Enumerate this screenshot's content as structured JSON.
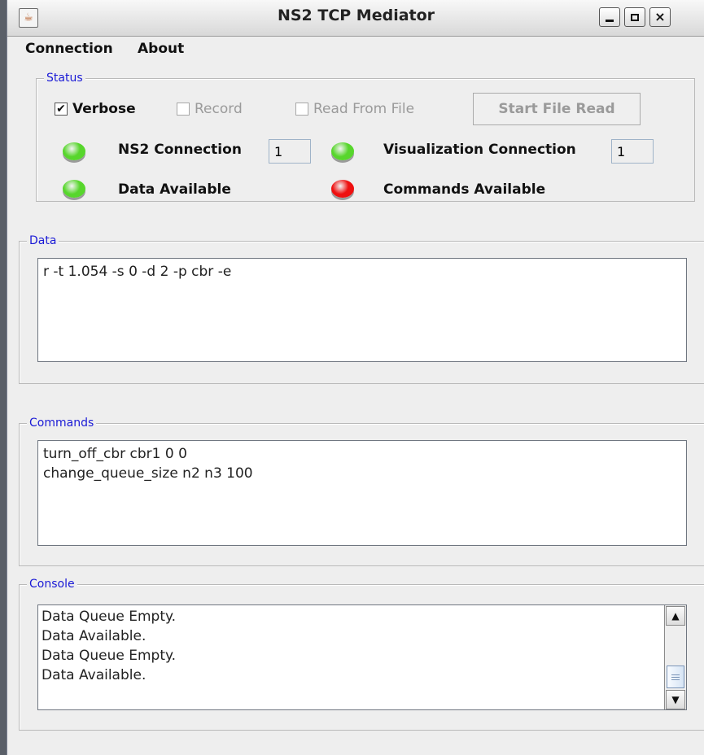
{
  "window": {
    "title": "NS2 TCP Mediator"
  },
  "menu": [
    "Connection",
    "About"
  ],
  "status": {
    "label": "Status",
    "verbose": {
      "label": "Verbose",
      "checked": true
    },
    "record": {
      "label": "Record",
      "checked": false
    },
    "read_from_file": {
      "label": "Read From File",
      "checked": false
    },
    "start_file_read": "Start File Read",
    "ns2_connection": {
      "label": "NS2 Connection",
      "value": "1",
      "color": "#57d62c"
    },
    "visualization_connection": {
      "label": "Visualization Connection",
      "value": "1",
      "color": "#57d62c"
    },
    "data_available": {
      "label": "Data Available",
      "color": "#57d62c"
    },
    "commands_available": {
      "label": "Commands Available",
      "color": "#ee1010"
    }
  },
  "data_panel": {
    "label": "Data",
    "lines": [
      "r -t 1.054 -s 0 -d 2 -p cbr -e"
    ]
  },
  "commands_panel": {
    "label": "Commands",
    "lines": [
      "turn_off_cbr cbr1 0 0",
      "change_queue_size n2 n3 100"
    ]
  },
  "console_panel": {
    "label": "Console",
    "lines": [
      "Data Queue Empty.",
      "Data Available.",
      "Data Queue Empty.",
      "Data Available."
    ]
  },
  "icons": {
    "app": "java-cup-icon",
    "minimize": "minimize-icon",
    "maximize": "maximize-icon",
    "close": "close-icon"
  }
}
